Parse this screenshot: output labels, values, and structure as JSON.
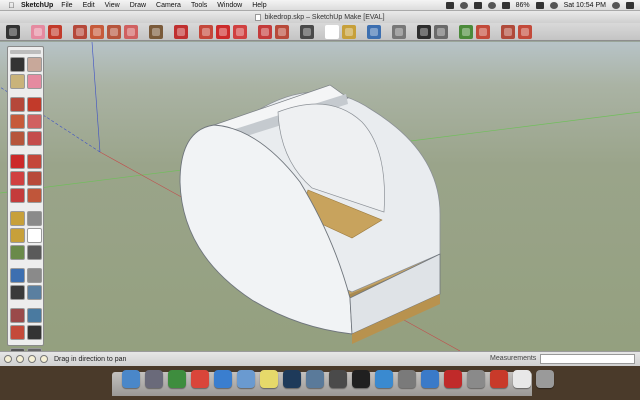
{
  "menubar": {
    "apple": "",
    "app_name": "SketchUp",
    "items": [
      "File",
      "Edit",
      "View",
      "Draw",
      "Camera",
      "Tools",
      "Window",
      "Help"
    ],
    "battery": "86%",
    "clock": "Sat 10:54 PM"
  },
  "window": {
    "title": "bikedrop.skp – SketchUp Make [EVAL]"
  },
  "toolbar": {
    "tools": [
      {
        "icon": "select-arrow-icon",
        "color": "#333333"
      },
      {
        "icon": "eraser-icon",
        "color": "#e58aa0"
      },
      {
        "icon": "pencil-icon",
        "color": "#c23a2a"
      },
      {
        "icon": "rectangle-icon",
        "color": "#b5483a"
      },
      {
        "icon": "circle-icon",
        "color": "#c65a3a"
      },
      {
        "icon": "polygon-icon",
        "color": "#b6553c"
      },
      {
        "icon": "arc-icon",
        "color": "#d06060"
      },
      {
        "icon": "make-component-icon",
        "color": "#7a5a3a"
      },
      {
        "icon": "paint-bucket-icon",
        "color": "#c03030"
      },
      {
        "icon": "push-pull-icon",
        "color": "#c4473a"
      },
      {
        "icon": "move-icon",
        "color": "#cc2a2a"
      },
      {
        "icon": "rotate-icon",
        "color": "#d04040"
      },
      {
        "icon": "scale-icon",
        "color": "#c43b3b"
      },
      {
        "icon": "offset-icon",
        "color": "#b84a3a"
      },
      {
        "icon": "tape-measure-icon",
        "color": "#4a4a4a"
      },
      {
        "icon": "text-icon",
        "color": "#ffffff"
      },
      {
        "icon": "protractor-icon",
        "color": "#c7a03a"
      },
      {
        "icon": "orbit-icon",
        "color": "#3d6fb0"
      },
      {
        "icon": "pan-icon",
        "color": "#777777"
      },
      {
        "icon": "zoom-icon",
        "color": "#2d2d2d"
      },
      {
        "icon": "zoom-extents-icon",
        "color": "#6a6a6a"
      },
      {
        "icon": "previous-view-icon",
        "color": "#4b8a3a"
      },
      {
        "icon": "get-models-icon",
        "color": "#c24a3a"
      },
      {
        "icon": "share-model-icon",
        "color": "#b04a3a"
      },
      {
        "icon": "extension-warehouse-icon",
        "color": "#c34a3a"
      }
    ]
  },
  "palette": {
    "tools": [
      {
        "icon": "select-arrow-icon",
        "color": "#333333"
      },
      {
        "icon": "make-component-icon",
        "color": "#c8a89a"
      },
      {
        "icon": "paint-bucket-icon",
        "color": "#c9b37a"
      },
      {
        "icon": "eraser-icon",
        "color": "#e58aa0"
      },
      {
        "icon": "rectangle-icon",
        "color": "#b5483a"
      },
      {
        "icon": "pencil-icon",
        "color": "#c23a2a"
      },
      {
        "icon": "circle-icon",
        "color": "#c65a3a"
      },
      {
        "icon": "arc-icon",
        "color": "#d06060"
      },
      {
        "icon": "polygon-icon",
        "color": "#b6553c"
      },
      {
        "icon": "freehand-icon",
        "color": "#c44c4c"
      },
      {
        "icon": "move-icon",
        "color": "#cc2a2a"
      },
      {
        "icon": "push-pull-icon",
        "color": "#c4473a"
      },
      {
        "icon": "rotate-icon",
        "color": "#d04040"
      },
      {
        "icon": "follow-me-icon",
        "color": "#b84a3a"
      },
      {
        "icon": "scale-icon",
        "color": "#c43b3b"
      },
      {
        "icon": "offset-icon",
        "color": "#c0563a"
      },
      {
        "icon": "tape-measure-icon",
        "color": "#c7a03a"
      },
      {
        "icon": "dimension-icon",
        "color": "#8a8a8a"
      },
      {
        "icon": "protractor-icon",
        "color": "#c7a03a"
      },
      {
        "icon": "text-icon",
        "color": "#ffffff"
      },
      {
        "icon": "axes-icon",
        "color": "#6a8a4a"
      },
      {
        "icon": "3d-text-icon",
        "color": "#5a5a5a"
      },
      {
        "icon": "orbit-icon",
        "color": "#3d6fb0"
      },
      {
        "icon": "pan-icon",
        "color": "#8a8a8a"
      },
      {
        "icon": "zoom-icon",
        "color": "#3a3a3a"
      },
      {
        "icon": "zoom-window-icon",
        "color": "#5a7fa0"
      },
      {
        "icon": "zoom-extents-icon",
        "color": "#9a4a4a"
      },
      {
        "icon": "previous-view-icon",
        "color": "#4a7aa0"
      },
      {
        "icon": "position-camera-icon",
        "color": "#c44a3a"
      },
      {
        "icon": "walk-icon",
        "color": "#333333"
      },
      {
        "icon": "look-around-icon",
        "color": "#555555"
      },
      {
        "icon": "section-plane-icon",
        "color": "#666666"
      }
    ]
  },
  "statusbar": {
    "text": "Drag in direction to pan",
    "measurements_label": "Measurements",
    "measurements_value": ""
  },
  "dock": {
    "apps": [
      {
        "icon": "finder-icon",
        "color": "#4a87c9"
      },
      {
        "icon": "launchpad-icon",
        "color": "#6a6a7a"
      },
      {
        "icon": "system-utility-icon",
        "color": "#3e8d3e"
      },
      {
        "icon": "chrome-icon",
        "color": "#d9453a"
      },
      {
        "icon": "safari-icon",
        "color": "#3a7ecf"
      },
      {
        "icon": "mail-icon",
        "color": "#6a9ad0"
      },
      {
        "icon": "stickies-icon",
        "color": "#e6d96a"
      },
      {
        "icon": "photos-icon",
        "color": "#1e3a5a"
      },
      {
        "icon": "preview-icon",
        "color": "#5a7a9a"
      },
      {
        "icon": "image-capture-icon",
        "color": "#4a4a4a"
      },
      {
        "icon": "terminal-icon",
        "color": "#202020"
      },
      {
        "icon": "itunes-icon",
        "color": "#3a8ad0"
      },
      {
        "icon": "system-preferences-icon",
        "color": "#7a7a7a"
      },
      {
        "icon": "app-store-icon",
        "color": "#3a7ac8"
      },
      {
        "icon": "acrobat-icon",
        "color": "#c02a2a"
      },
      {
        "icon": "sketchup-dock-icon",
        "color": "#8a8a8a"
      },
      {
        "icon": "flash-icon",
        "color": "#c83a2a"
      },
      {
        "icon": "document-icon",
        "color": "#e8e8e8"
      },
      {
        "icon": "trash-icon",
        "color": "#9a9a9a"
      }
    ]
  }
}
